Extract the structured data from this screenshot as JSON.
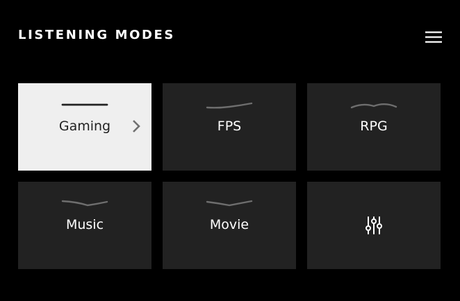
{
  "header": {
    "title": "LISTENING MODES",
    "menu_icon": "hamburger-menu-icon"
  },
  "modes": [
    {
      "label": "Gaming",
      "selected": true,
      "curve_icon": "flat-eq-curve-icon"
    },
    {
      "label": "FPS",
      "selected": false,
      "curve_icon": "fps-eq-curve-icon"
    },
    {
      "label": "RPG",
      "selected": false,
      "curve_icon": "rpg-eq-curve-icon"
    },
    {
      "label": "Music",
      "selected": false,
      "curve_icon": "music-eq-curve-icon"
    },
    {
      "label": "Movie",
      "selected": false,
      "curve_icon": "movie-eq-curve-icon"
    }
  ],
  "custom_tile": {
    "icon": "equalizer-sliders-icon"
  },
  "colors": {
    "background": "#000000",
    "tile": "#222222",
    "tile_selected": "#efefef",
    "text": "#ffffff",
    "text_selected": "#222222",
    "curve": "#6e6e6e",
    "chevron": "#707070"
  }
}
